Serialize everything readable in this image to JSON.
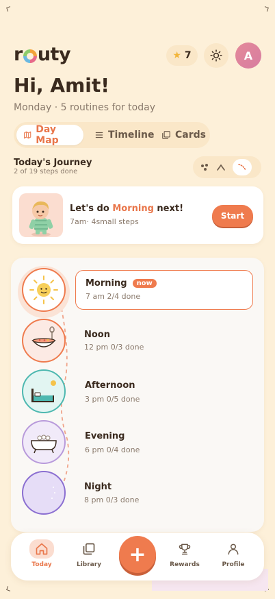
{
  "app": {
    "logo_pre": "r",
    "logo_post": "uty"
  },
  "header": {
    "stars_count": "7",
    "avatar_initial": "A",
    "greeting": "Hi, Amit!",
    "subtitle": "Monday · 5 routines for today"
  },
  "view_tabs": [
    {
      "label": "Day Map",
      "icon": "map-icon",
      "active": true
    },
    {
      "label": "Timeline",
      "icon": "list-icon",
      "active": false
    },
    {
      "label": "Cards",
      "icon": "cards-icon",
      "active": false
    }
  ],
  "journey": {
    "title": "Today's Journey",
    "subtitle": "2 of 19 steps done"
  },
  "next_card": {
    "prefix": "Let's do",
    "highlight": "Morning",
    "suffix": "next!",
    "meta": "7am·  4small steps",
    "button": "Start"
  },
  "routines": [
    {
      "name": "Morning",
      "meta": "7 am 2/4 done",
      "badge": "now",
      "color": "#EF7B4E",
      "icon": "sun-icon"
    },
    {
      "name": "Noon",
      "meta": "12 pm 0/3 done",
      "color": "#EF7B4E",
      "icon": "bowl-icon"
    },
    {
      "name": "Afternoon",
      "meta": "3 pm 0/5 done",
      "color": "#4DB8B0",
      "icon": "bed-icon"
    },
    {
      "name": "Evening",
      "meta": "6 pm 0/4 done",
      "color": "#B89ADB",
      "icon": "bathtub-icon"
    },
    {
      "name": "Night",
      "meta": "8 pm 0/3 done",
      "color": "#8B6FD1",
      "icon": "moon-icon"
    }
  ],
  "bottom_nav": [
    {
      "label": "Today",
      "icon": "home-icon",
      "active": true
    },
    {
      "label": "Library",
      "icon": "library-icon",
      "active": false
    },
    {
      "label": "Rewards",
      "icon": "trophy-icon",
      "active": false
    },
    {
      "label": "Profile",
      "icon": "profile-icon",
      "active": false
    }
  ],
  "fab": {
    "label": "+",
    "icon": "plus-icon"
  }
}
